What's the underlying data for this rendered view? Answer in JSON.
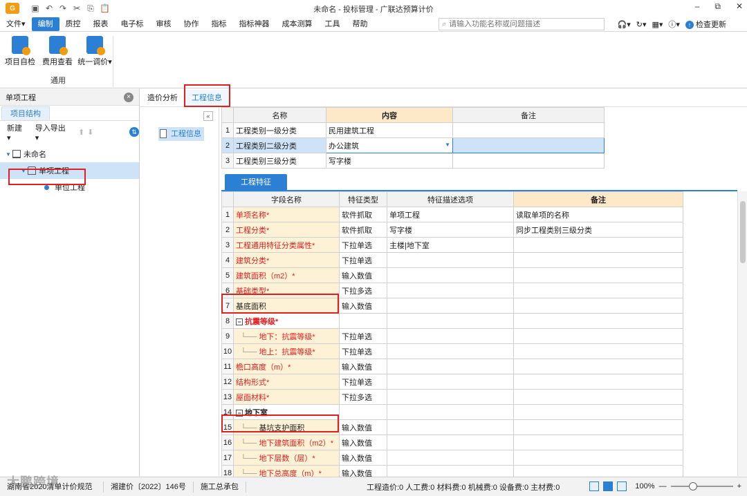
{
  "window": {
    "title": "未命名 - 投标管理 - 广联达预算计价",
    "controls": [
      "–",
      "⧉",
      "✕"
    ]
  },
  "menu": {
    "items": [
      "文件▾",
      "编制",
      "质控",
      "报表",
      "电子标",
      "审核",
      "协作",
      "指标",
      "指标神器",
      "成本测算",
      "工具",
      "帮助"
    ],
    "active_index": 1,
    "search_placeholder": "请输入功能名称或问题描述",
    "right": {
      "check_update": "检查更新"
    }
  },
  "ribbon": {
    "buttons": [
      "项目自检",
      "费用查看",
      "统一调价▾"
    ],
    "group_label": "通用"
  },
  "left_panel": {
    "title": "单项工程",
    "tab": "项目结构",
    "toolbar": {
      "new": "新建▾",
      "import_export": "导入导出▾"
    },
    "tree": [
      {
        "label": "未命名",
        "level": 0
      },
      {
        "label": "单项工程",
        "level": 1,
        "selected": true
      },
      {
        "label": "单位工程",
        "level": 2
      }
    ]
  },
  "tabs": [
    "造价分析",
    "工程信息"
  ],
  "active_tab": 1,
  "nav": {
    "item": "工程信息"
  },
  "info_table": {
    "headers": [
      "名称",
      "内容",
      "备注"
    ],
    "rows": [
      {
        "num": "1",
        "name": "工程类别一级分类",
        "value": "民用建筑工程",
        "note": ""
      },
      {
        "num": "2",
        "name": "工程类别二级分类",
        "value": "办公建筑",
        "note": ""
      },
      {
        "num": "3",
        "name": "工程类别三级分类",
        "value": "写字楼",
        "note": ""
      }
    ]
  },
  "features": {
    "tab": "工程特征",
    "headers": [
      "字段名称",
      "特征类型",
      "特征描述选项",
      "备注"
    ],
    "rows": [
      {
        "num": "1",
        "name": "单项名称*",
        "type": "软件抓取",
        "option": "单项工程",
        "note": "读取单项的名称",
        "red": true
      },
      {
        "num": "2",
        "name": "工程分类*",
        "type": "软件抓取",
        "option": "写字楼",
        "note": "同步工程类别三级分类",
        "red": true
      },
      {
        "num": "3",
        "name": "工程通用特征分类属性*",
        "type": "下拉单选",
        "option": "主楼|地下室",
        "note": "",
        "red": true
      },
      {
        "num": "4",
        "name": "建筑分类*",
        "type": "下拉单选",
        "option": "",
        "note": "",
        "red": true
      },
      {
        "num": "5",
        "name": "建筑面积（m2）*",
        "type": "输入数值",
        "option": "",
        "note": "",
        "red": true
      },
      {
        "num": "6",
        "name": "基础类型*",
        "type": "下拉多选",
        "option": "",
        "note": "",
        "red": true
      },
      {
        "num": "7",
        "name": "基底面积",
        "type": "输入数值",
        "option": "",
        "note": "",
        "red": false
      },
      {
        "num": "8",
        "name": "抗震等级*",
        "type": "",
        "option": "",
        "note": "",
        "red": true,
        "group": true
      },
      {
        "num": "9",
        "name": "地下：抗震等级*",
        "type": "下拉单选",
        "option": "",
        "note": "",
        "red": true,
        "child": true
      },
      {
        "num": "10",
        "name": "地上：抗震等级*",
        "type": "下拉单选",
        "option": "",
        "note": "",
        "red": true,
        "child": true
      },
      {
        "num": "11",
        "name": "檐口高度（m）*",
        "type": "输入数值",
        "option": "",
        "note": "",
        "red": true
      },
      {
        "num": "12",
        "name": "结构形式*",
        "type": "下拉单选",
        "option": "",
        "note": "",
        "red": true
      },
      {
        "num": "13",
        "name": "屋面材料*",
        "type": "下拉多选",
        "option": "",
        "note": "",
        "red": true
      },
      {
        "num": "14",
        "name": "地下室",
        "type": "",
        "option": "",
        "note": "",
        "red": false,
        "group": true
      },
      {
        "num": "15",
        "name": "基坑支护面积",
        "type": "输入数值",
        "option": "",
        "note": "",
        "red": false,
        "child": true
      },
      {
        "num": "16",
        "name": "地下建筑面积（m2）*",
        "type": "输入数值",
        "option": "",
        "note": "",
        "red": true,
        "child": true
      },
      {
        "num": "17",
        "name": "地下层数（层）*",
        "type": "输入数值",
        "option": "",
        "note": "",
        "red": true,
        "child": true
      },
      {
        "num": "18",
        "name": "地下总高度（m）*",
        "type": "输入数值",
        "option": "",
        "note": "",
        "red": true,
        "child": true
      }
    ]
  },
  "statusbar": {
    "items": [
      "湖南省2020清单计价规范",
      "湘建价〔2022〕146号",
      "施工总承包"
    ],
    "costs": "工程造价:0  人工费:0  材料费:0  机械费:0  设备费:0  主材费:0",
    "zoom": "100%"
  },
  "watermark": "大鹏跨境"
}
